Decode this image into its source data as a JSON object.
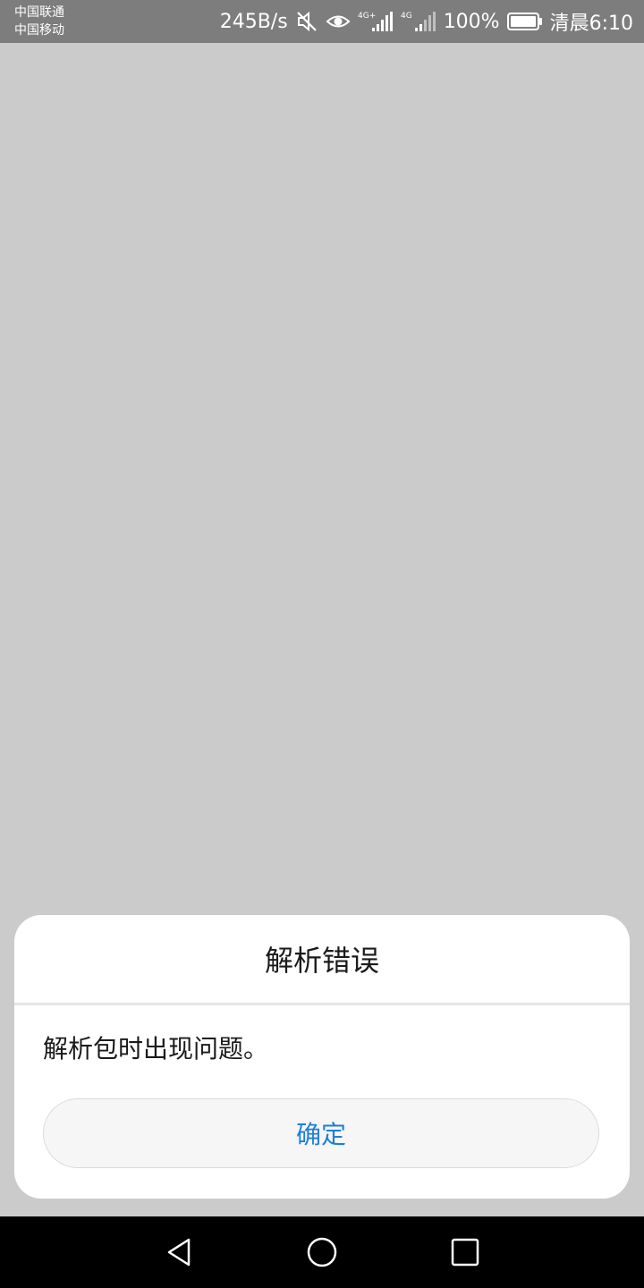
{
  "status_bar": {
    "carrier_1": "中国联通",
    "carrier_2": "中国移动",
    "net_speed": "245B/s",
    "icons": [
      "mute-icon",
      "eye-icon",
      "signal-4g-plus-icon",
      "signal-4g-icon",
      "battery-icon"
    ],
    "signal_1_label": "4G+",
    "signal_2_label": "4G",
    "battery": "100%",
    "time": "清晨6:10"
  },
  "dialog": {
    "title": "解析错误",
    "message": "解析包时出现问题。",
    "ok_label": "确定"
  },
  "nav_bar": {
    "icons": [
      "back-icon",
      "home-icon",
      "recent-apps-icon"
    ]
  },
  "colors": {
    "background": "#cbcbcb",
    "status_bar": "#7d7d7d",
    "dialog": "#ffffff",
    "accent": "#1e7fd6",
    "nav_bar": "#000000"
  }
}
